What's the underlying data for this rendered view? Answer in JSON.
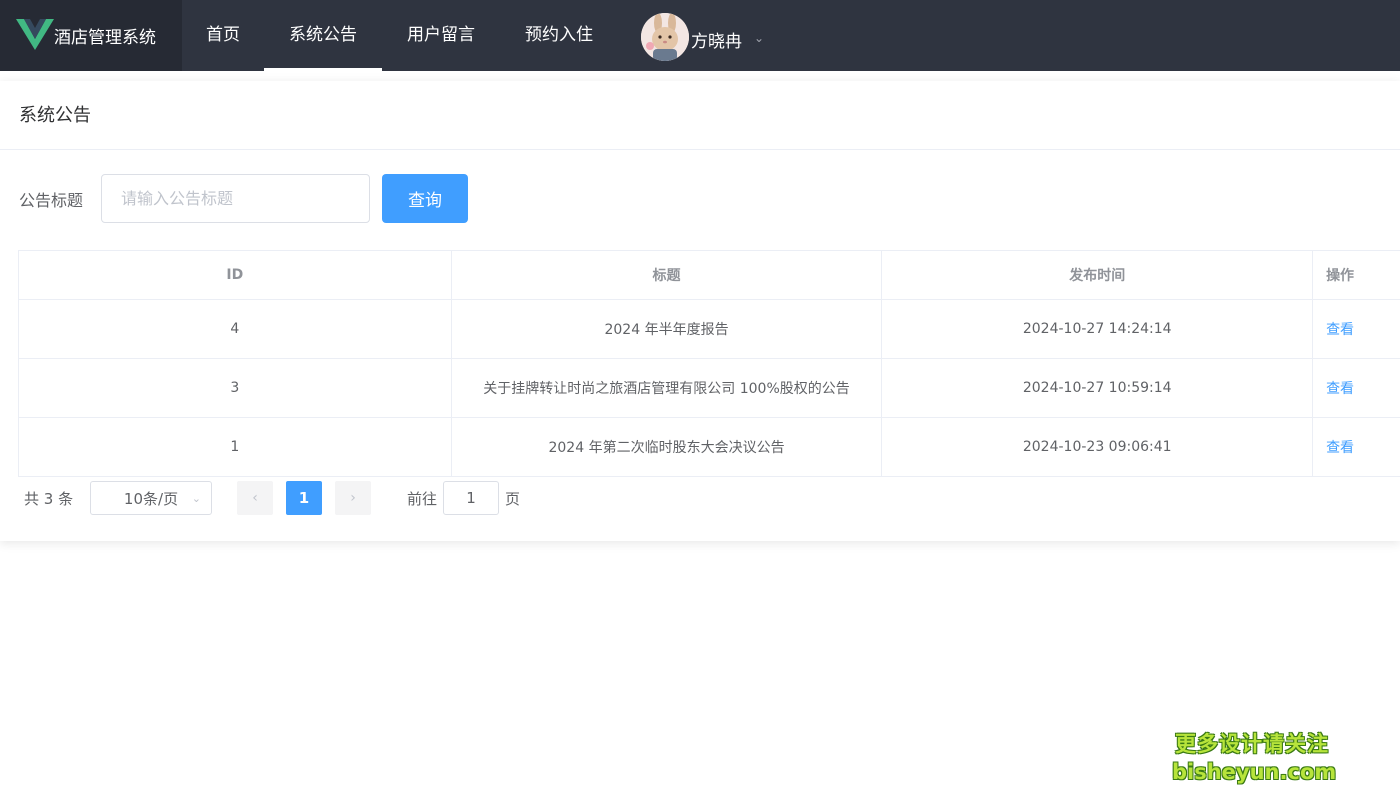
{
  "colors": {
    "nav_bg": "#2f3440",
    "brand_bg": "#262a34",
    "accent": "#409eff",
    "logo_green": "#41b883",
    "logo_dark": "#35495e"
  },
  "brand": {
    "title": "酒店管理系统",
    "logo_icon": "vue-logo-icon"
  },
  "nav": {
    "items": [
      {
        "label": "首页",
        "active": false
      },
      {
        "label": "系统公告",
        "active": true
      },
      {
        "label": "用户留言",
        "active": false
      },
      {
        "label": "预约入住",
        "active": false
      }
    ],
    "user": {
      "name": "方晓冉",
      "avatar_icon": "rabbit-avatar-icon",
      "dropdown_icon": "chevron-down-icon"
    }
  },
  "page": {
    "title": "系统公告",
    "search": {
      "label": "公告标题",
      "placeholder": "请输入公告标题",
      "value": "",
      "button": "查询"
    }
  },
  "table": {
    "columns": [
      "ID",
      "标题",
      "发布时间",
      "操作"
    ],
    "rows": [
      {
        "id": "4",
        "title": "2024 年半年度报告",
        "time": "2024-10-27 14:24:14",
        "action": "查看"
      },
      {
        "id": "3",
        "title": "关于挂牌转让时尚之旅酒店管理有限公司 100%股权的公告",
        "time": "2024-10-27 10:59:14",
        "action": "查看"
      },
      {
        "id": "1",
        "title": "2024 年第二次临时股东大会决议公告",
        "time": "2024-10-23 09:06:41",
        "action": "查看"
      }
    ]
  },
  "pagination": {
    "total_text": "共 3 条",
    "page_size": "10条/页",
    "current_page": "1",
    "goto_label": "前往",
    "goto_value": "1",
    "goto_suffix": "页",
    "prev_icon": "chevron-left-icon",
    "next_icon": "chevron-right-icon"
  },
  "watermark": {
    "line1": "更多设计请关注",
    "line2": "bisheyun.com"
  }
}
